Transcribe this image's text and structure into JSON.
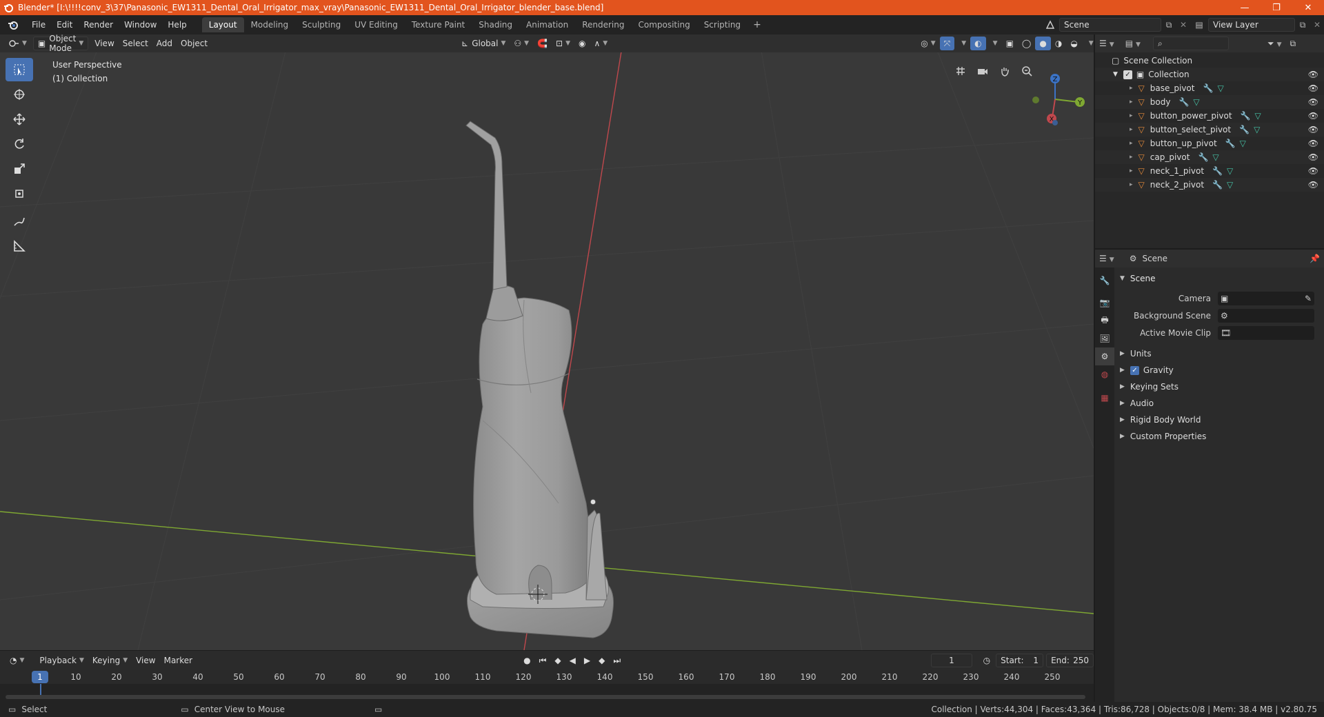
{
  "window": {
    "title": "Blender* [I:\\!!!!conv_3\\37\\Panasonic_EW1311_Dental_Oral_Irrigator_max_vray\\Panasonic_EW1311_Dental_Oral_Irrigator_blender_base.blend]",
    "controls": [
      "—",
      "❐",
      "✕"
    ]
  },
  "menu": [
    "File",
    "Edit",
    "Render",
    "Window",
    "Help"
  ],
  "workspaces": [
    "Layout",
    "Modeling",
    "Sculpting",
    "UV Editing",
    "Texture Paint",
    "Shading",
    "Animation",
    "Rendering",
    "Compositing",
    "Scripting"
  ],
  "active_workspace": "Layout",
  "scene_selector": {
    "label": "Scene"
  },
  "view_layer_selector": {
    "label": "View Layer"
  },
  "viewport_header": {
    "mode": "Object Mode",
    "menus": [
      "View",
      "Select",
      "Add",
      "Object"
    ],
    "orientation": "Global"
  },
  "viewport": {
    "perspective": "User Perspective",
    "collection": "(1) Collection"
  },
  "gizmo": {
    "x": "X",
    "y": "Y",
    "z": "Z"
  },
  "outliner": {
    "root": "Scene Collection",
    "collection": "Collection",
    "items": [
      "base_pivot",
      "body",
      "button_power_pivot",
      "button_select_pivot",
      "button_up_pivot",
      "cap_pivot",
      "neck_1_pivot",
      "neck_2_pivot"
    ]
  },
  "properties": {
    "context": "Scene",
    "panel_title": "Scene",
    "fields": [
      {
        "label": "Camera",
        "value": ""
      },
      {
        "label": "Background Scene",
        "value": ""
      },
      {
        "label": "Active Movie Clip",
        "value": ""
      }
    ],
    "subpanels": [
      "Units",
      "Gravity",
      "Keying Sets",
      "Audio",
      "Rigid Body World",
      "Custom Properties"
    ],
    "gravity_checked": true
  },
  "timeline": {
    "menus": [
      "Playback",
      "Keying",
      "View",
      "Marker"
    ],
    "current_frame": "1",
    "start_label": "Start:",
    "start": "1",
    "end_label": "End:",
    "end": "250",
    "ruler": [
      "1",
      "10",
      "20",
      "30",
      "40",
      "50",
      "60",
      "70",
      "80",
      "90",
      "100",
      "110",
      "120",
      "130",
      "140",
      "150",
      "160",
      "170",
      "180",
      "190",
      "200",
      "210",
      "220",
      "230",
      "240",
      "250"
    ]
  },
  "statusbar": {
    "select": "Select",
    "center_view": "Center View to Mouse",
    "stats": "Collection | Verts:44,304 | Faces:43,364 | Tris:86,728 | Objects:0/8 | Mem: 38.4 MB | v2.80.75"
  },
  "colors": {
    "titlebar": "#e2541e",
    "accent": "#4772b3",
    "viewport_bg": "#393939",
    "axis_x": "#c0484d",
    "axis_y": "#7fa832",
    "object_orange": "#e48a3a",
    "modifier_blue": "#6f9ad6",
    "mesh_green": "#46c3a7"
  }
}
